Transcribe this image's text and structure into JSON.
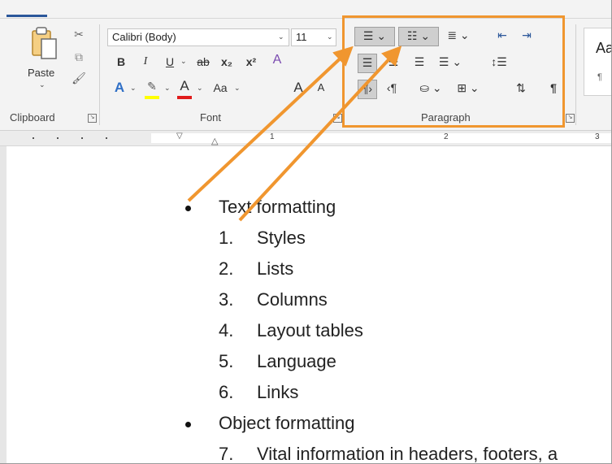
{
  "ribbon": {
    "clipboard": {
      "paste_label": "Paste",
      "group_label": "Clipboard"
    },
    "font": {
      "font_name": "Calibri (Body)",
      "font_size": "11",
      "bold": "B",
      "italic": "I",
      "underline": "U",
      "strikethrough": "ab",
      "subscript": "x₂",
      "superscript": "x²",
      "change_case": "Aa",
      "grow_font": "A",
      "shrink_font": "A",
      "group_label": "Font"
    },
    "paragraph": {
      "group_label": "Paragraph",
      "pilcrow": "¶"
    },
    "styles": {
      "preview_text": "Aa",
      "preview_mark": "¶"
    }
  },
  "ruler": {
    "numbers": [
      "1",
      "2",
      "3"
    ]
  },
  "document": {
    "bullet_items": [
      {
        "text": "Text formatting",
        "numbered": [
          "1.",
          "Styles",
          "2.",
          "Lists",
          "3.",
          "Columns",
          "4.",
          "Layout tables",
          "5.",
          "Language",
          "6.",
          "Links"
        ]
      },
      {
        "text": "Object formatting",
        "numbered": [
          "7.",
          "Vital information in headers, footers, a"
        ]
      }
    ]
  },
  "colors": {
    "accent": "#2b579a",
    "highlight_box": "#f0962f",
    "arrow": "#f0962f",
    "text_effect_blue": "#2f6fc6",
    "highlighter_yellow": "#ffff00",
    "font_color_red": "#e01b1b"
  },
  "icons": [
    "cut-icon",
    "copy-icon",
    "format-painter-icon",
    "bullets-icon",
    "numbering-icon",
    "multilevel-list-icon",
    "decrease-indent-icon",
    "increase-indent-icon",
    "align-left-icon",
    "align-center-icon",
    "align-right-icon",
    "justify-icon",
    "line-spacing-icon",
    "ltr-icon",
    "rtl-icon",
    "shading-icon",
    "borders-icon",
    "sort-icon",
    "show-marks-icon"
  ]
}
